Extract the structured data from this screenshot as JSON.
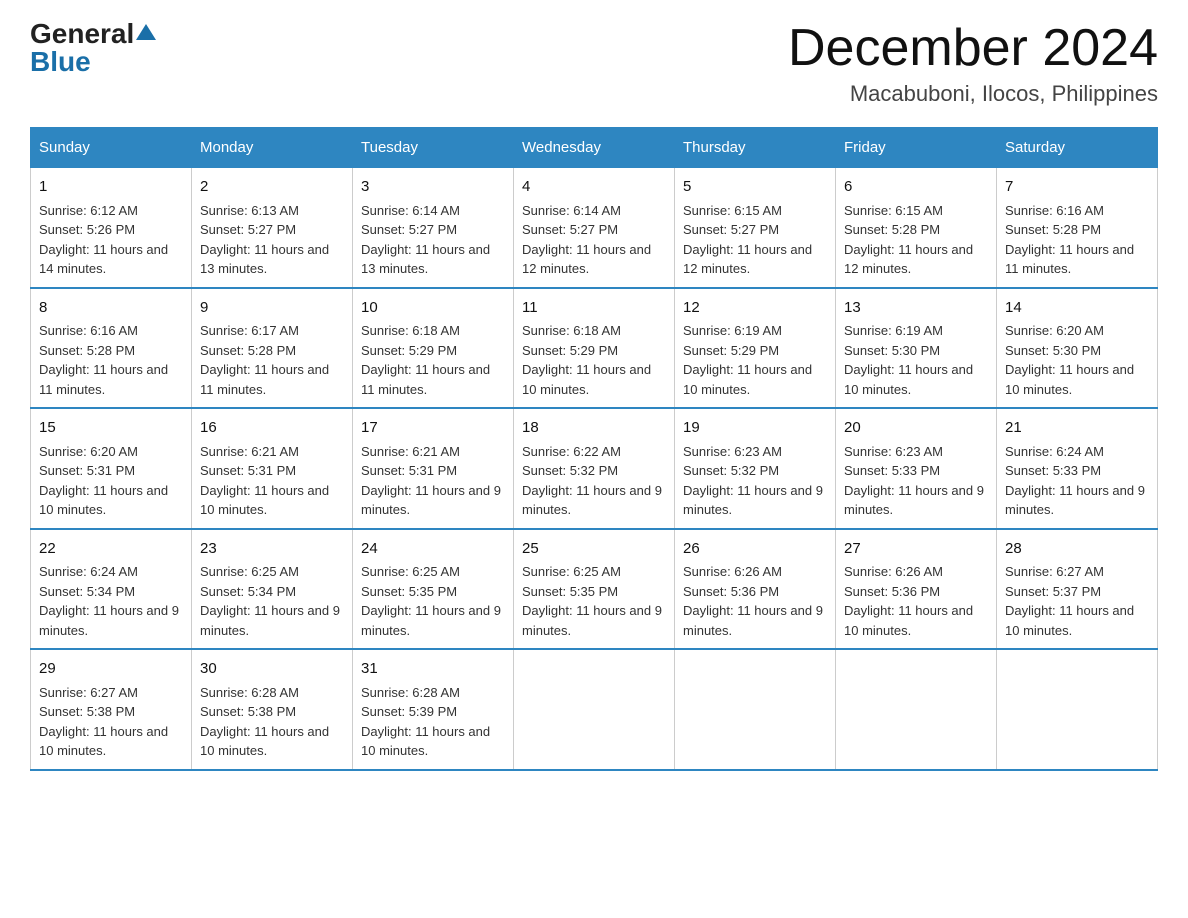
{
  "header": {
    "logo_general": "General",
    "logo_blue": "Blue",
    "title": "December 2024",
    "subtitle": "Macabuboni, Ilocos, Philippines"
  },
  "days_of_week": [
    "Sunday",
    "Monday",
    "Tuesday",
    "Wednesday",
    "Thursday",
    "Friday",
    "Saturday"
  ],
  "weeks": [
    [
      {
        "num": "1",
        "sunrise": "6:12 AM",
        "sunset": "5:26 PM",
        "daylight": "11 hours and 14 minutes."
      },
      {
        "num": "2",
        "sunrise": "6:13 AM",
        "sunset": "5:27 PM",
        "daylight": "11 hours and 13 minutes."
      },
      {
        "num": "3",
        "sunrise": "6:14 AM",
        "sunset": "5:27 PM",
        "daylight": "11 hours and 13 minutes."
      },
      {
        "num": "4",
        "sunrise": "6:14 AM",
        "sunset": "5:27 PM",
        "daylight": "11 hours and 12 minutes."
      },
      {
        "num": "5",
        "sunrise": "6:15 AM",
        "sunset": "5:27 PM",
        "daylight": "11 hours and 12 minutes."
      },
      {
        "num": "6",
        "sunrise": "6:15 AM",
        "sunset": "5:28 PM",
        "daylight": "11 hours and 12 minutes."
      },
      {
        "num": "7",
        "sunrise": "6:16 AM",
        "sunset": "5:28 PM",
        "daylight": "11 hours and 11 minutes."
      }
    ],
    [
      {
        "num": "8",
        "sunrise": "6:16 AM",
        "sunset": "5:28 PM",
        "daylight": "11 hours and 11 minutes."
      },
      {
        "num": "9",
        "sunrise": "6:17 AM",
        "sunset": "5:28 PM",
        "daylight": "11 hours and 11 minutes."
      },
      {
        "num": "10",
        "sunrise": "6:18 AM",
        "sunset": "5:29 PM",
        "daylight": "11 hours and 11 minutes."
      },
      {
        "num": "11",
        "sunrise": "6:18 AM",
        "sunset": "5:29 PM",
        "daylight": "11 hours and 10 minutes."
      },
      {
        "num": "12",
        "sunrise": "6:19 AM",
        "sunset": "5:29 PM",
        "daylight": "11 hours and 10 minutes."
      },
      {
        "num": "13",
        "sunrise": "6:19 AM",
        "sunset": "5:30 PM",
        "daylight": "11 hours and 10 minutes."
      },
      {
        "num": "14",
        "sunrise": "6:20 AM",
        "sunset": "5:30 PM",
        "daylight": "11 hours and 10 minutes."
      }
    ],
    [
      {
        "num": "15",
        "sunrise": "6:20 AM",
        "sunset": "5:31 PM",
        "daylight": "11 hours and 10 minutes."
      },
      {
        "num": "16",
        "sunrise": "6:21 AM",
        "sunset": "5:31 PM",
        "daylight": "11 hours and 10 minutes."
      },
      {
        "num": "17",
        "sunrise": "6:21 AM",
        "sunset": "5:31 PM",
        "daylight": "11 hours and 9 minutes."
      },
      {
        "num": "18",
        "sunrise": "6:22 AM",
        "sunset": "5:32 PM",
        "daylight": "11 hours and 9 minutes."
      },
      {
        "num": "19",
        "sunrise": "6:23 AM",
        "sunset": "5:32 PM",
        "daylight": "11 hours and 9 minutes."
      },
      {
        "num": "20",
        "sunrise": "6:23 AM",
        "sunset": "5:33 PM",
        "daylight": "11 hours and 9 minutes."
      },
      {
        "num": "21",
        "sunrise": "6:24 AM",
        "sunset": "5:33 PM",
        "daylight": "11 hours and 9 minutes."
      }
    ],
    [
      {
        "num": "22",
        "sunrise": "6:24 AM",
        "sunset": "5:34 PM",
        "daylight": "11 hours and 9 minutes."
      },
      {
        "num": "23",
        "sunrise": "6:25 AM",
        "sunset": "5:34 PM",
        "daylight": "11 hours and 9 minutes."
      },
      {
        "num": "24",
        "sunrise": "6:25 AM",
        "sunset": "5:35 PM",
        "daylight": "11 hours and 9 minutes."
      },
      {
        "num": "25",
        "sunrise": "6:25 AM",
        "sunset": "5:35 PM",
        "daylight": "11 hours and 9 minutes."
      },
      {
        "num": "26",
        "sunrise": "6:26 AM",
        "sunset": "5:36 PM",
        "daylight": "11 hours and 9 minutes."
      },
      {
        "num": "27",
        "sunrise": "6:26 AM",
        "sunset": "5:36 PM",
        "daylight": "11 hours and 10 minutes."
      },
      {
        "num": "28",
        "sunrise": "6:27 AM",
        "sunset": "5:37 PM",
        "daylight": "11 hours and 10 minutes."
      }
    ],
    [
      {
        "num": "29",
        "sunrise": "6:27 AM",
        "sunset": "5:38 PM",
        "daylight": "11 hours and 10 minutes."
      },
      {
        "num": "30",
        "sunrise": "6:28 AM",
        "sunset": "5:38 PM",
        "daylight": "11 hours and 10 minutes."
      },
      {
        "num": "31",
        "sunrise": "6:28 AM",
        "sunset": "5:39 PM",
        "daylight": "11 hours and 10 minutes."
      },
      {
        "num": "",
        "sunrise": "",
        "sunset": "",
        "daylight": ""
      },
      {
        "num": "",
        "sunrise": "",
        "sunset": "",
        "daylight": ""
      },
      {
        "num": "",
        "sunrise": "",
        "sunset": "",
        "daylight": ""
      },
      {
        "num": "",
        "sunrise": "",
        "sunset": "",
        "daylight": ""
      }
    ]
  ]
}
